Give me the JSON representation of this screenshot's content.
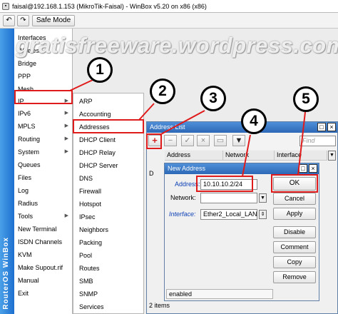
{
  "titlebar": {
    "icon": "winbox-icon",
    "text": "faisal@192.168.1.153 (MikroTik-Faisal) - WinBox v5.20 on x86 (x86)"
  },
  "toolbar": {
    "undo": "↶",
    "redo": "↷",
    "safe_mode": "Safe Mode"
  },
  "sidebar_brand": "RouterOS WinBox",
  "watermark": "gratisfreeware.wordpress.com",
  "main_menu": [
    "Interfaces",
    "Wireless",
    "Bridge",
    "PPP",
    "Mesh",
    "IP",
    "IPv6",
    "MPLS",
    "Routing",
    "System",
    "Queues",
    "Files",
    "Log",
    "Radius",
    "Tools",
    "New Terminal",
    "ISDN Channels",
    "KVM",
    "Make Supout.rif",
    "Manual",
    "Exit"
  ],
  "ip_submenu": [
    "ARP",
    "Accounting",
    "Addresses",
    "DHCP Client",
    "DHCP Relay",
    "DHCP Server",
    "DNS",
    "Firewall",
    "Hotspot",
    "IPsec",
    "Neighbors",
    "Packing",
    "Pool",
    "Routes",
    "SMB",
    "SNMP",
    "Services"
  ],
  "address_list": {
    "title": "Address List",
    "find_placeholder": "Find",
    "columns": [
      "Address",
      "Network",
      "Interface"
    ],
    "row_flag": "D",
    "status": "2 items"
  },
  "new_address": {
    "title": "New Address",
    "address_label": "Address:",
    "address_value": "10.10.10.2/24",
    "network_label": "Network:",
    "network_value": "",
    "interface_label": "Interface:",
    "interface_value": "Ether2_Local_LAN",
    "status": "enabled",
    "buttons": {
      "ok": "OK",
      "cancel": "Cancel",
      "apply": "Apply",
      "disable": "Disable",
      "comment": "Comment",
      "copy": "Copy",
      "remove": "Remove"
    }
  },
  "callouts": [
    "1",
    "2",
    "3",
    "4",
    "5"
  ],
  "colors": {
    "highlight": "#e01b1b",
    "title_bar": "#2d68b6",
    "sidebar": "#1d6fcf"
  }
}
